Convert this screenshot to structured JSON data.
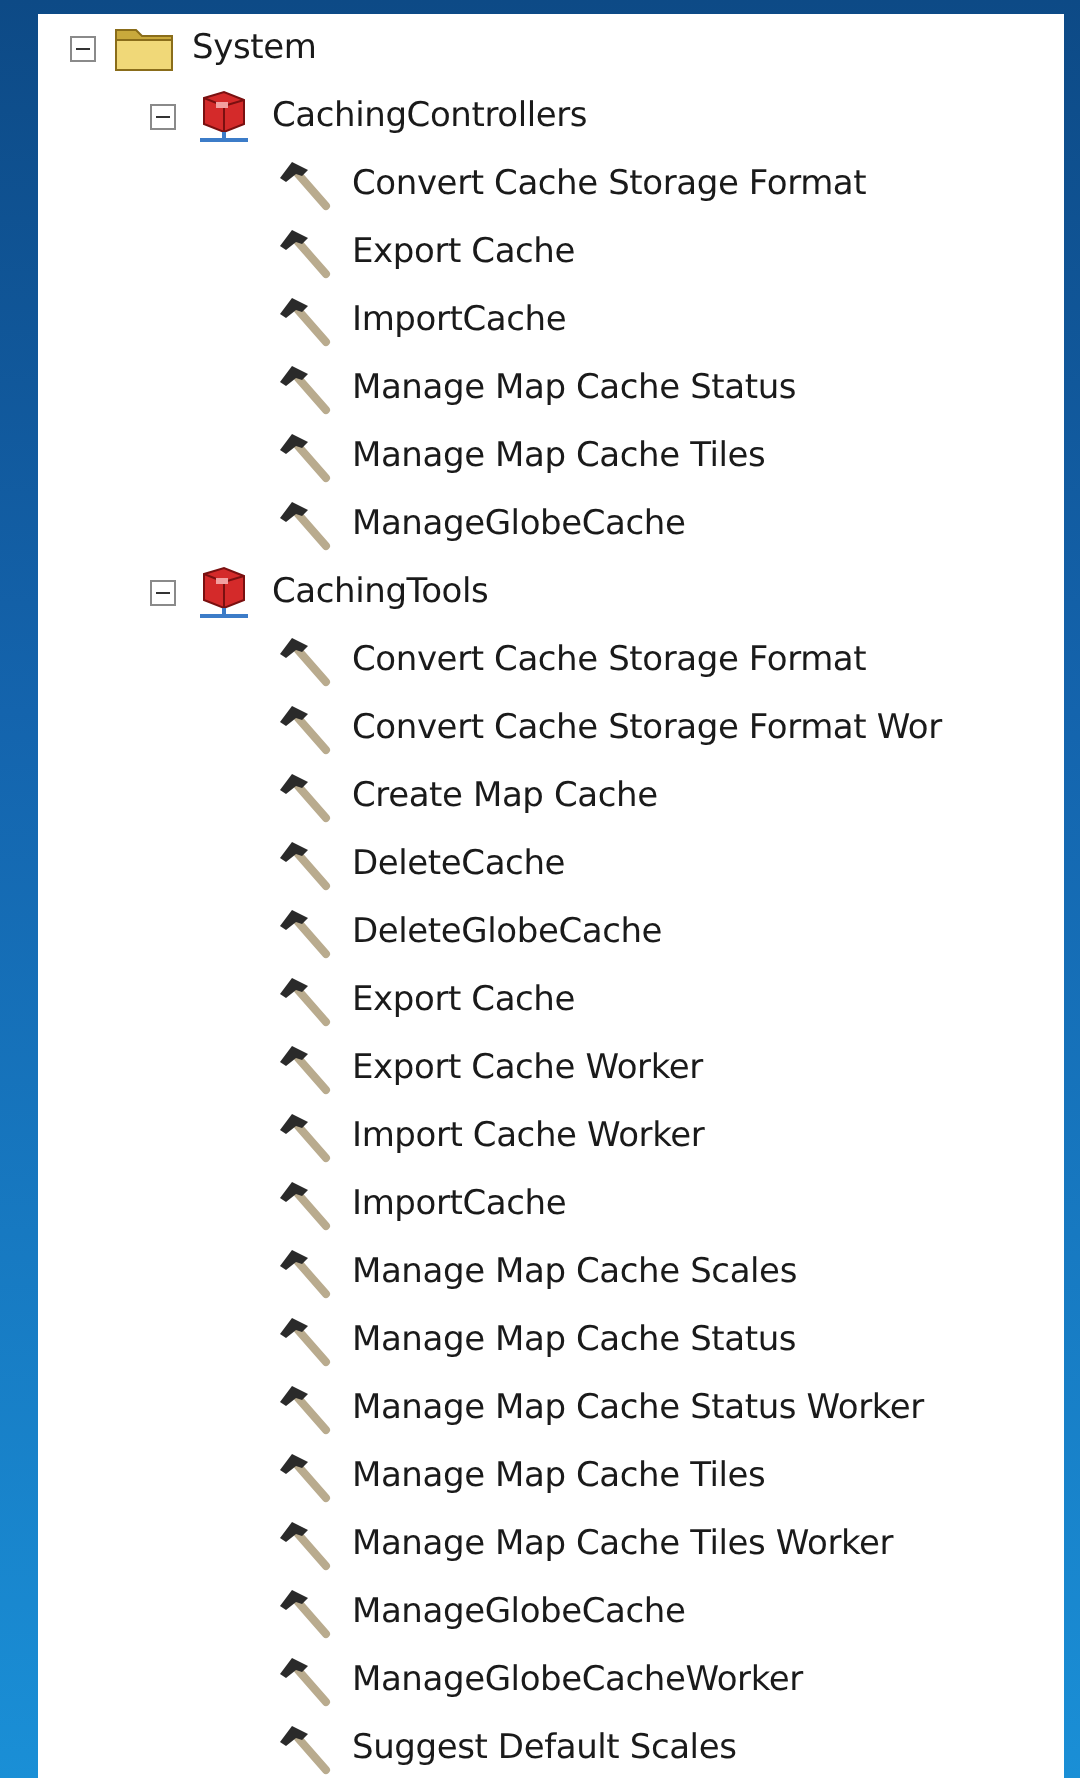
{
  "tree": [
    {
      "label": "System",
      "kind": "folder",
      "expanded": true,
      "children": [
        {
          "label": "CachingControllers",
          "kind": "toolbox",
          "expanded": true,
          "children": [
            {
              "label": "Convert Cache Storage Format",
              "kind": "tool"
            },
            {
              "label": "Export Cache",
              "kind": "tool"
            },
            {
              "label": "ImportCache",
              "kind": "tool"
            },
            {
              "label": "Manage Map Cache Status",
              "kind": "tool"
            },
            {
              "label": "Manage Map Cache Tiles",
              "kind": "tool"
            },
            {
              "label": "ManageGlobeCache",
              "kind": "tool"
            }
          ]
        },
        {
          "label": "CachingTools",
          "kind": "toolbox",
          "expanded": true,
          "children": [
            {
              "label": "Convert Cache Storage Format",
              "kind": "tool"
            },
            {
              "label": "Convert Cache Storage Format Wor",
              "kind": "tool"
            },
            {
              "label": "Create Map Cache",
              "kind": "tool"
            },
            {
              "label": "DeleteCache",
              "kind": "tool"
            },
            {
              "label": "DeleteGlobeCache",
              "kind": "tool"
            },
            {
              "label": "Export Cache",
              "kind": "tool"
            },
            {
              "label": "Export Cache Worker",
              "kind": "tool"
            },
            {
              "label": "Import Cache Worker",
              "kind": "tool"
            },
            {
              "label": "ImportCache",
              "kind": "tool"
            },
            {
              "label": "Manage Map Cache Scales",
              "kind": "tool"
            },
            {
              "label": "Manage Map Cache Status",
              "kind": "tool"
            },
            {
              "label": "Manage Map Cache Status Worker",
              "kind": "tool"
            },
            {
              "label": "Manage Map Cache Tiles",
              "kind": "tool"
            },
            {
              "label": "Manage Map Cache Tiles Worker",
              "kind": "tool"
            },
            {
              "label": "ManageGlobeCache",
              "kind": "tool"
            },
            {
              "label": "ManageGlobeCacheWorker",
              "kind": "tool"
            },
            {
              "label": "Suggest Default Scales",
              "kind": "tool"
            }
          ]
        }
      ]
    }
  ]
}
